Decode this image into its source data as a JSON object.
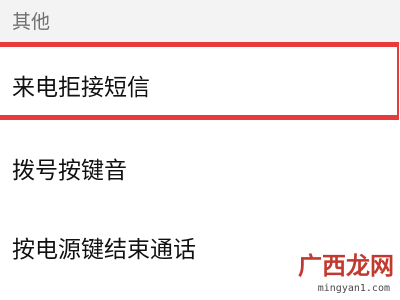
{
  "section": {
    "title": "其他"
  },
  "settings": {
    "items": [
      {
        "label": "来电拒接短信"
      },
      {
        "label": "拨号按键音"
      },
      {
        "label": "按电源键结束通话"
      }
    ]
  },
  "highlight": {
    "color": "#e8393b"
  },
  "watermark": {
    "logo_text": "广西龙网",
    "url_text": "mingyan1.com"
  }
}
